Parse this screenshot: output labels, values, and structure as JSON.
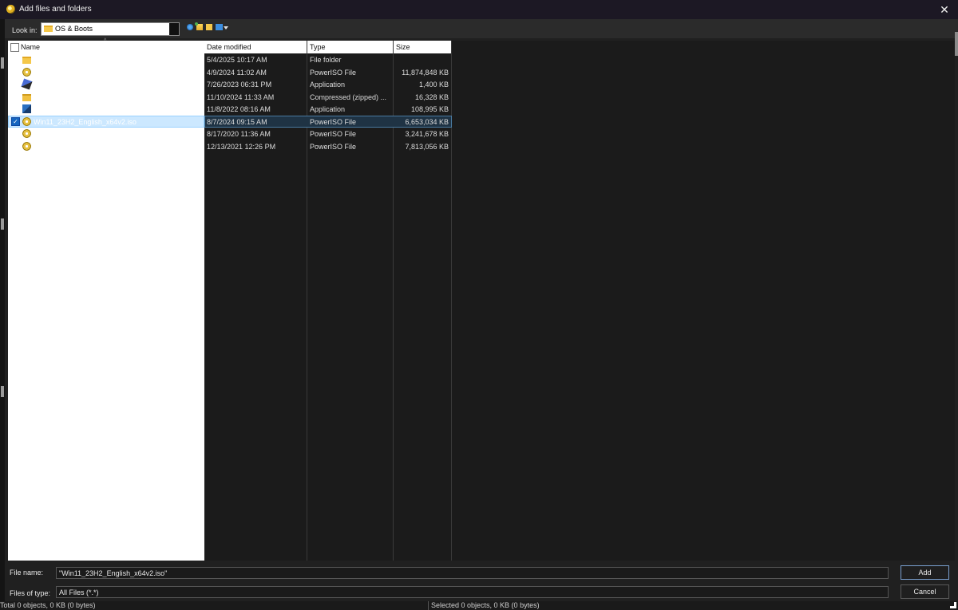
{
  "window": {
    "title": "Add files and folders",
    "close_glyph": "✕"
  },
  "toolbar": {
    "lookin_label": "Look in:",
    "lookin_value": "OS & Boots",
    "icons": [
      "up-one-level-icon",
      "new-item-icon",
      "create-folder-icon",
      "view-menu-icon"
    ]
  },
  "columns": {
    "name": "Name",
    "date": "Date modified",
    "type": "Type",
    "size": "Size"
  },
  "files": [
    {
      "name": "",
      "date": "5/4/2025 10:17 AM",
      "type": "File folder",
      "size": "",
      "icon": "folder-icon"
    },
    {
      "name": "",
      "date": "4/9/2024 11:02 AM",
      "type": "PowerISO File",
      "size": "11,874,848 KB",
      "icon": "iso-file-icon"
    },
    {
      "name": "",
      "date": "7/26/2023 06:31 PM",
      "type": "Application",
      "size": "1,400 KB",
      "icon": "application-icon"
    },
    {
      "name": "",
      "date": "11/10/2024 11:33 AM",
      "type": "Compressed (zipped) ...",
      "size": "16,328 KB",
      "icon": "zip-folder-icon"
    },
    {
      "name": "",
      "date": "11/8/2022 08:16 AM",
      "type": "Application",
      "size": "108,995 KB",
      "icon": "virtualbox-icon"
    },
    {
      "name": "Win11_23H2_English_x64v2.iso",
      "date": "8/7/2024 09:15 AM",
      "type": "PowerISO File",
      "size": "6,653,034 KB",
      "icon": "iso-file-icon",
      "selected": true
    },
    {
      "name": "",
      "date": "8/17/2020 11:36 AM",
      "type": "PowerISO File",
      "size": "3,241,678 KB",
      "icon": "iso-file-icon"
    },
    {
      "name": "",
      "date": "12/13/2021 12:26 PM",
      "type": "PowerISO File",
      "size": "7,813,056 KB",
      "icon": "iso-file-icon"
    }
  ],
  "bottom": {
    "filename_label": "File name:",
    "filename_value": "\"Win11_23H2_English_x64v2.iso\"",
    "filetype_label": "Files of type:",
    "filetype_value": "All Files (*.*)",
    "add_label": "Add",
    "cancel_label": "Cancel"
  },
  "status": {
    "left": "Total 0 objects, 0 KB (0 bytes)",
    "right": "Selected 0 objects, 0 KB (0 bytes)"
  }
}
